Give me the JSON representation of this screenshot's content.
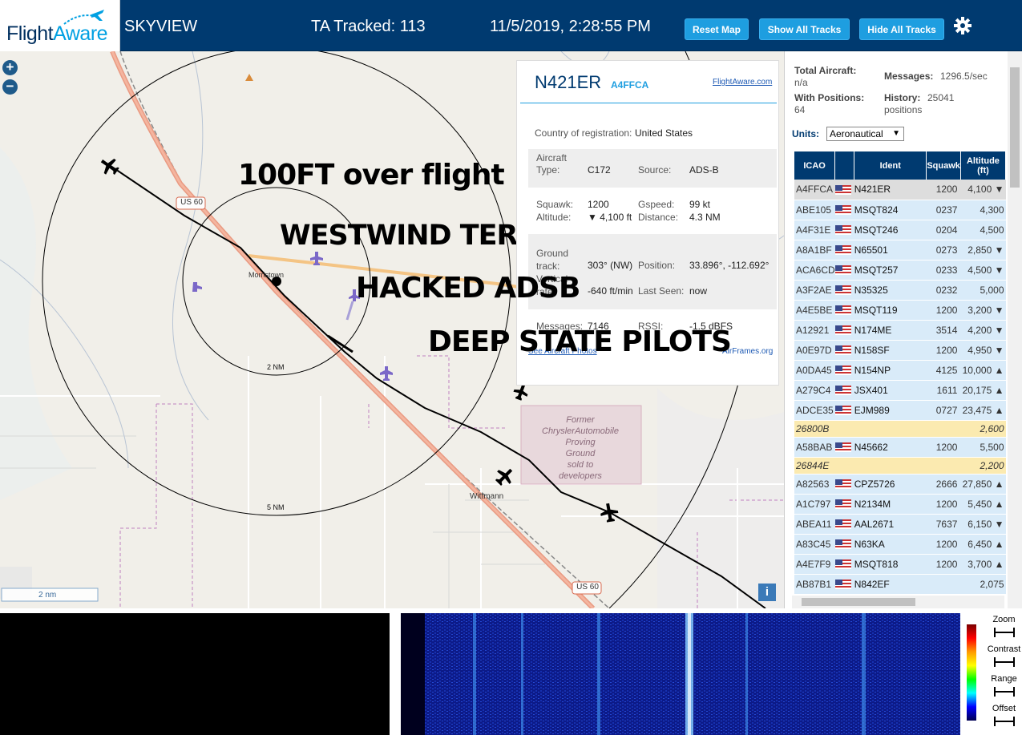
{
  "header": {
    "logo_flight": "Flight",
    "logo_aware": "Aware",
    "app_title": "SKYVIEW",
    "ta_tracked": "TA Tracked: 113",
    "datetime": "11/5/2019, 2:28:55 PM",
    "btn_reset": "Reset Map",
    "btn_show": "Show All Tracks",
    "btn_hide": "Hide All Tracks"
  },
  "map": {
    "zoom_in": "+",
    "zoom_out": "−",
    "road_us60_a": "US 60",
    "road_us60_b": "US 60",
    "town_morristown": "Morristown",
    "town_wittmann": "Wittmann",
    "ring_2nm": "2 NM",
    "ring_5nm": "5 NM",
    "proving_ground": "Former ChryslerAutomobile Proving Ground sold to developers",
    "scale": "2 nm",
    "info_button": "i",
    "overlay_1": "100FT over flight",
    "overlay_2": "WESTWIND TERRORISM",
    "overlay_3": "HACKED ADSB",
    "overlay_4": "DEEP STATE PILOTS"
  },
  "info_panel": {
    "ident": "N421ER",
    "icao": "A4FFCA",
    "fa_link": "FlightAware.com",
    "country_label": "Country of registration:",
    "country_value": "United States",
    "aircraft_type_label": "Aircraft Type:",
    "aircraft_type_value": "C172",
    "source_label": "Source:",
    "source_value": "ADS-B",
    "squawk_label": "Squawk:",
    "squawk_value": "1200",
    "gspeed_label": "Gspeed:",
    "gspeed_value": "99 kt",
    "altitude_label": "Altitude:",
    "altitude_value": "▼ 4,100 ft",
    "distance_label": "Distance:",
    "distance_value": "4.3 NM",
    "ground_track_label": "Ground track:",
    "ground_track_value": "303° (NW)",
    "position_label": "Position:",
    "position_value": "33.896°, -112.692°",
    "vertical_rate_label": "Vertical rate:",
    "vertical_rate_value": "-640 ft/min",
    "last_seen_label": "Last Seen:",
    "last_seen_value": "now",
    "messages_label": "Messages:",
    "messages_value": "7146",
    "rssi_label": "RSSI:",
    "rssi_value": "-1.5 dBFS",
    "photos_link": "See Aircraft Photos",
    "airframes_link": "AirFrames.org"
  },
  "sidebar": {
    "total_aircraft_label": "Total Aircraft:",
    "total_aircraft_value": "n/a",
    "messages_label": "Messages:",
    "messages_value": "1296.5/sec",
    "with_positions_label": "With Positions:",
    "with_positions_value": "64",
    "history_label": "History:",
    "history_value": "25041",
    "history_unit": "positions",
    "units_label": "Units:",
    "units_value": "Aeronautical",
    "columns": [
      "ICAO",
      "",
      "Ident",
      "Squawk",
      "Altitude (ft)"
    ],
    "rows": [
      {
        "icao": "A4FFCA",
        "flag": true,
        "ident": "N421ER",
        "squawk": "1200",
        "alt": "4,100 ▼",
        "sel": true
      },
      {
        "icao": "ABE105",
        "flag": true,
        "ident": "MSQT824",
        "squawk": "0237",
        "alt": "4,300"
      },
      {
        "icao": "A4F31E",
        "flag": true,
        "ident": "MSQT246",
        "squawk": "0204",
        "alt": "4,500"
      },
      {
        "icao": "A8A1BF",
        "flag": true,
        "ident": "N65501",
        "squawk": "0273",
        "alt": "2,850 ▼"
      },
      {
        "icao": "ACA6CD",
        "flag": true,
        "ident": "MSQT257",
        "squawk": "0233",
        "alt": "4,500 ▼"
      },
      {
        "icao": "A3F2AE",
        "flag": true,
        "ident": "N35325",
        "squawk": "0232",
        "alt": "5,000"
      },
      {
        "icao": "A4E5BE",
        "flag": true,
        "ident": "MSQT119",
        "squawk": "1200",
        "alt": "3,200 ▼"
      },
      {
        "icao": "A12921",
        "flag": true,
        "ident": "N174ME",
        "squawk": "3514",
        "alt": "4,200 ▼"
      },
      {
        "icao": "A0E97D",
        "flag": true,
        "ident": "N158SF",
        "squawk": "1200",
        "alt": "4,950 ▼"
      },
      {
        "icao": "A0DA45",
        "flag": true,
        "ident": "N154NP",
        "squawk": "4125",
        "alt": "10,000 ▲"
      },
      {
        "icao": "A279C4",
        "flag": true,
        "ident": "JSX401",
        "squawk": "1611",
        "alt": "20,175 ▲"
      },
      {
        "icao": "ADCE35",
        "flag": true,
        "ident": "EJM989",
        "squawk": "0727",
        "alt": "23,475 ▲"
      },
      {
        "icao": "26800B",
        "flag": false,
        "ident": "",
        "squawk": "",
        "alt": "2,600",
        "nopos": true
      },
      {
        "icao": "A58BAB",
        "flag": true,
        "ident": "N45662",
        "squawk": "1200",
        "alt": "5,500"
      },
      {
        "icao": "26844E",
        "flag": false,
        "ident": "",
        "squawk": "",
        "alt": "2,200",
        "nopos": true
      },
      {
        "icao": "A82563",
        "flag": true,
        "ident": "CPZ5726",
        "squawk": "2666",
        "alt": "27,850 ▲"
      },
      {
        "icao": "A1C797",
        "flag": true,
        "ident": "N2134M",
        "squawk": "1200",
        "alt": "5,450 ▲"
      },
      {
        "icao": "ABEA11",
        "flag": true,
        "ident": "AAL2671",
        "squawk": "7637",
        "alt": "6,150 ▼"
      },
      {
        "icao": "A83C45",
        "flag": true,
        "ident": "N63KA",
        "squawk": "1200",
        "alt": "6,450 ▲"
      },
      {
        "icao": "A4E7F9",
        "flag": true,
        "ident": "MSQT818",
        "squawk": "1200",
        "alt": "3,700 ▲"
      },
      {
        "icao": "AB87B1",
        "flag": true,
        "ident": "N842EF",
        "squawk": "",
        "alt": "2,075"
      }
    ]
  },
  "controls": {
    "zoom": "Zoom",
    "contrast": "Contrast",
    "range": "Range",
    "offset": "Offset"
  },
  "colors": {
    "header_bg": "#003a70",
    "button_bg": "#1e9ee0",
    "row_bg": "#d9ebf9",
    "nopos_bg": "#fbeab0"
  }
}
